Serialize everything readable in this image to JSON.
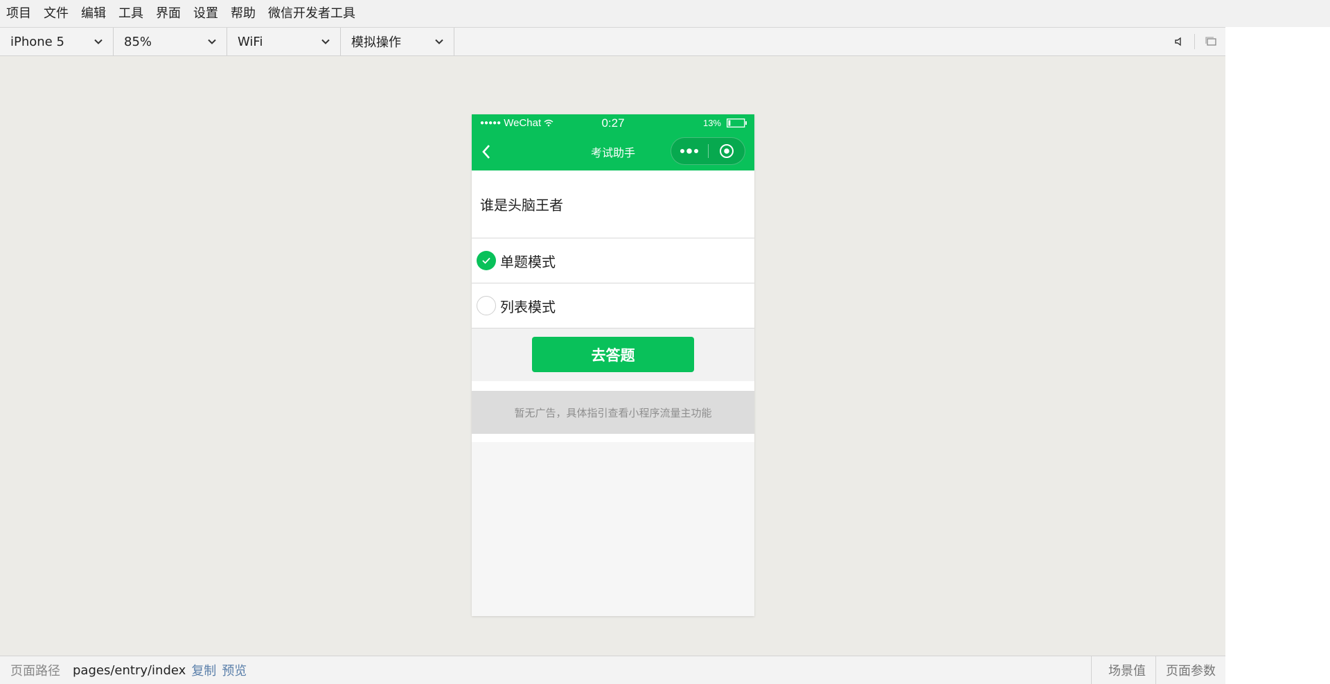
{
  "menubar": {
    "items": [
      "项目",
      "文件",
      "编辑",
      "工具",
      "界面",
      "设置",
      "帮助",
      "微信开发者工具"
    ]
  },
  "toolbar": {
    "device": "iPhone 5",
    "zoom": "85%",
    "network": "WiFi",
    "operation": "模拟操作"
  },
  "phone": {
    "status": {
      "signal": "●●●●●",
      "carrier": "WeChat",
      "time": "0:27",
      "battery_pct": "13%",
      "battery_level": 0.13
    },
    "nav": {
      "title": "考试助手"
    },
    "heading": "谁是头脑王者",
    "options": [
      {
        "label": "单题模式",
        "checked": true
      },
      {
        "label": "列表模式",
        "checked": false
      }
    ],
    "button_label": "去答题",
    "ad_text": "暂无广告，具体指引查看小程序流量主功能"
  },
  "bottombar": {
    "path_label": "页面路径",
    "path_value": "pages/entry/index",
    "copy_link": "复制",
    "preview_link": "预览",
    "scene_label": "场景值",
    "params_label": "页面参数"
  },
  "colors": {
    "accent": "#09c15a",
    "workspace": "#ecebe7",
    "link": "#5a7faa"
  }
}
